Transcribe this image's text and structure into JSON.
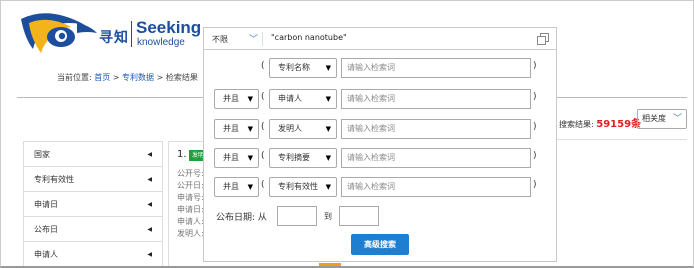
{
  "logo": {
    "cn_text": "寻知",
    "en_title": "Seeking",
    "en_sub": "knowledge"
  },
  "breadcrumb": {
    "prefix": "当前位置:",
    "home": "首页",
    "sep1": ">",
    "section": "专利数据",
    "sep2": ">",
    "current": "检索结果"
  },
  "search": {
    "scope_label": "不限",
    "query": "\"carbon nanotube\""
  },
  "advanced": {
    "rows": [
      {
        "op": "",
        "lparen": "(",
        "field": "专利名称",
        "placeholder": "请输入检索词",
        "rparen": ")"
      },
      {
        "op": "并且",
        "lparen": "(",
        "field": "申请人",
        "placeholder": "请输入检索词",
        "rparen": ")"
      },
      {
        "op": "并且",
        "lparen": "(",
        "field": "发明人",
        "placeholder": "请输入检索词",
        "rparen": ")"
      },
      {
        "op": "并且",
        "lparen": "(",
        "field": "专利摘要",
        "placeholder": "请输入检索词",
        "rparen": ")"
      },
      {
        "op": "并且",
        "lparen": "(",
        "field": "专利有效性",
        "placeholder": "请输入检索词",
        "rparen": ")"
      }
    ],
    "date_label": "公布日期:",
    "date_from": "从",
    "date_to": "到",
    "submit_label": "高级搜索"
  },
  "results": {
    "label": "搜索结果:",
    "count": "59159条",
    "sort_label": "相关度"
  },
  "sidebar": {
    "items": [
      {
        "label": "国家"
      },
      {
        "label": "专利有效性"
      },
      {
        "label": "申请日"
      },
      {
        "label": "公布日"
      },
      {
        "label": "申请人"
      }
    ]
  },
  "card": {
    "number": "1.",
    "badge": "发明",
    "meta": [
      "公开号:",
      "公开日:",
      "申请号:",
      "申请日:",
      "申请人:",
      "发明人:"
    ]
  },
  "colors": {
    "brand": "#1d4e9e",
    "button": "#1e7fd0",
    "count": "#e31d1d",
    "badge": "#1aa33c"
  }
}
